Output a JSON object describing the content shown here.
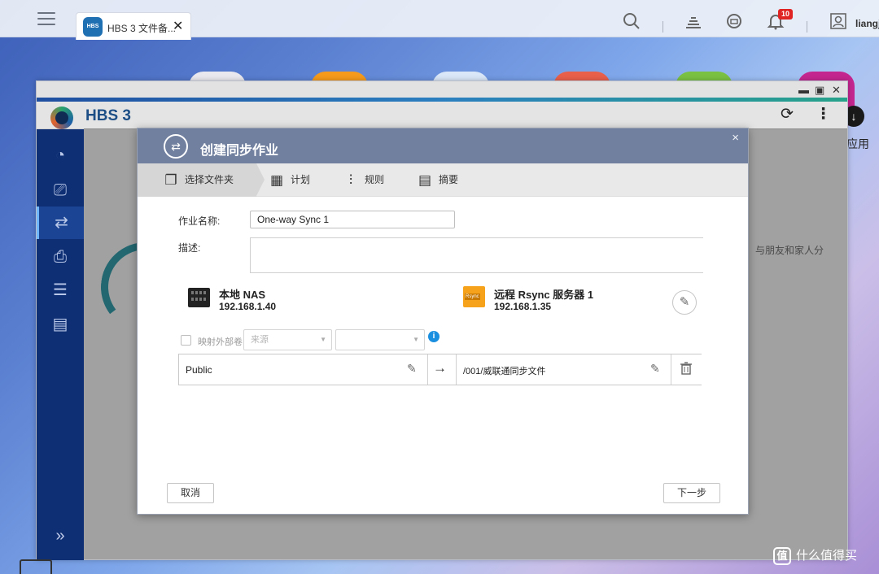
{
  "os": {
    "tab_label": "HBS 3 文件备...",
    "tab_logo_text": "HBS",
    "close_glyph": "✕",
    "notifications_count": "10",
    "user_name": "liangj",
    "icons": [
      "menu-icon",
      "search-icon",
      "task-icon",
      "sync-icon",
      "bell-icon",
      "user-icon"
    ]
  },
  "background": {
    "partial_text": "，与朋友和家人分",
    "app_label": "应用"
  },
  "hbs": {
    "title": "HBS 3",
    "window_controls": {
      "minimize": "▬",
      "maximize": "▣",
      "close": "✕"
    },
    "refresh": "⟳",
    "more": "⋮",
    "sidebar_expand": "»"
  },
  "dialog": {
    "title": "创建同步作业",
    "close": "×",
    "steps": [
      {
        "label": "选择文件夹",
        "active": true
      },
      {
        "label": "计划",
        "active": false
      },
      {
        "label": "规则",
        "active": false
      },
      {
        "label": "摘要",
        "active": false
      }
    ],
    "job_name_label": "作业名称:",
    "job_name_value": "One-way Sync 1",
    "description_label": "描述:",
    "local": {
      "title": "本地 NAS",
      "ip": "192.168.1.40"
    },
    "remote": {
      "title": "远程 Rsync 服务器 1",
      "ip": "192.168.1.35",
      "badge": "Rsync"
    },
    "map_external": {
      "label": "映射外部卷",
      "source_placeholder": "来源",
      "checked": false
    },
    "mapping": {
      "source": "Public",
      "arrow": "→",
      "destination": "/001/威联通同步文件"
    },
    "cancel_label": "取消",
    "next_label": "下一步"
  },
  "watermark": {
    "logo": "值",
    "text": "什么值得买"
  },
  "colors": {
    "dialog_header": "#72809f",
    "sidebar": "#0f2f74",
    "accent": "#1a8fe0"
  }
}
